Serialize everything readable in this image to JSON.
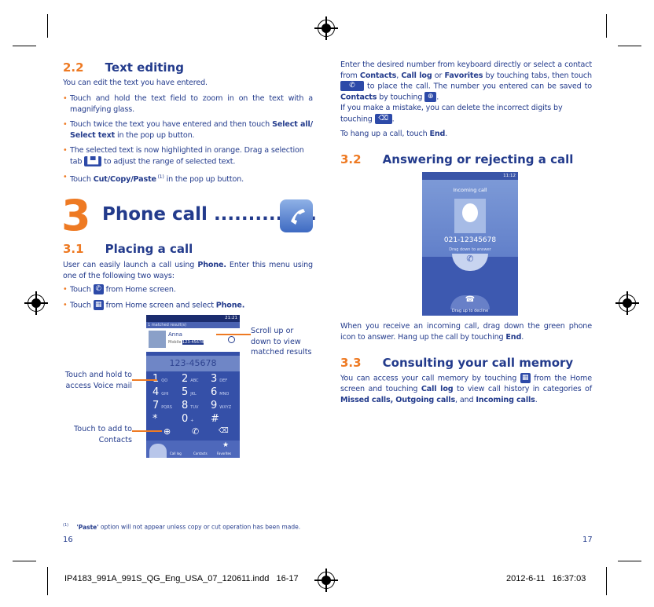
{
  "left": {
    "section_2_2": {
      "number": "2.2",
      "title": "Text editing"
    },
    "intro": "You can edit the text you have entered.",
    "bullets": [
      [
        {
          "t": "Touch and hold the text field to zoom in on the text with a magnifying glass."
        }
      ],
      [
        {
          "t": "Touch twice the text you have entered and then touch "
        },
        {
          "t": "Select all/ Select text",
          "b": true
        },
        {
          "t": " in the pop up button."
        }
      ],
      [
        {
          "t": "The selected text is now highlighted in orange. Drag a selection tab "
        },
        {
          "t": "[selection-tabs-icon]",
          "icon": "selection-tabs"
        },
        {
          "t": " to adjust the range of selected text."
        }
      ],
      [
        {
          "t": "Touch "
        },
        {
          "t": "Cut/Copy/Paste",
          "b": true
        },
        {
          "t": " (1)",
          "sup": true
        },
        {
          "t": " in the pop up button."
        }
      ]
    ],
    "chapter": {
      "number": "3",
      "title": "Phone call ...............",
      "icon": "phone-app-icon"
    },
    "section_3_1": {
      "number": "3.1",
      "title": "Placing a call"
    },
    "placing_intro": [
      {
        "t": "User can easily launch a call using "
      },
      {
        "t": "Phone.",
        "b": true
      },
      {
        "t": " Enter this menu using one of the following two ways:"
      }
    ],
    "placing_bullets": [
      [
        {
          "t": "Touch "
        },
        {
          "t": "[phone-icon]",
          "icon": "phone"
        },
        {
          "t": " from Home screen."
        }
      ],
      [
        {
          "t": "Touch "
        },
        {
          "t": "[apps-icon]",
          "icon": "apps"
        },
        {
          "t": " from Home screen and select "
        },
        {
          "t": "Phone.",
          "b": true
        }
      ]
    ],
    "dialer_screenshot": {
      "status_time": "21:21",
      "matched": "1 matched result(s)",
      "contact_name": "Anna",
      "contact_type": "Mobile",
      "contact_number": "123-45678",
      "display_number": "123-45678",
      "keys": [
        {
          "d": "1",
          "l": "QO"
        },
        {
          "d": "2",
          "l": "ABC"
        },
        {
          "d": "3",
          "l": "DEF"
        },
        {
          "d": "4",
          "l": "GHI"
        },
        {
          "d": "5",
          "l": "JKL"
        },
        {
          "d": "6",
          "l": "MNO"
        },
        {
          "d": "7",
          "l": "PQRS"
        },
        {
          "d": "8",
          "l": "TUV"
        },
        {
          "d": "9",
          "l": "WXYZ"
        },
        {
          "d": "*",
          "l": ""
        },
        {
          "d": "0",
          "l": "+"
        },
        {
          "d": "#",
          "l": ""
        }
      ],
      "tabs": [
        "Call log",
        "Contacts",
        "Favorites"
      ]
    },
    "callouts": {
      "scroll": "Scroll up or down to view matched results",
      "voicemail": "Touch and hold to access Voice mail",
      "add_contact": "Touch to add to Contacts"
    },
    "footnote": {
      "marker": "(1)",
      "bold": "'Paste'",
      "text": " option will not appear unless copy or cut operation has been made."
    },
    "page_number": "16"
  },
  "right": {
    "para1": [
      {
        "t": "Enter the desired number from keyboard directly or select a contact from "
      },
      {
        "t": "Contacts",
        "b": true
      },
      {
        "t": ", "
      },
      {
        "t": "Call log",
        "b": true
      },
      {
        "t": " or "
      },
      {
        "t": "Favorites",
        "b": true
      },
      {
        "t": " by touching tabs, then touch "
      },
      {
        "t": "[call-button-icon]",
        "icon": "call-button"
      },
      {
        "t": " to place the call. The number you entered can be saved to "
      },
      {
        "t": "Contacts",
        "b": true
      },
      {
        "t": " by touching "
      },
      {
        "t": "[add-contact-icon]",
        "icon": "add"
      },
      {
        "t": "."
      }
    ],
    "para2": [
      {
        "t": "If you make a mistake, you can delete the incorrect digits by touching "
      },
      {
        "t": "[delete-icon]",
        "icon": "delete"
      },
      {
        "t": "."
      }
    ],
    "para3": [
      {
        "t": "To hang up a call, touch "
      },
      {
        "t": "End",
        "b": true
      },
      {
        "t": "."
      }
    ],
    "section_3_2": {
      "number": "3.2",
      "title": "Answering or rejecting a call"
    },
    "incoming_screenshot": {
      "status_time": "11:12",
      "title": "Incoming call",
      "number": "021-12345678",
      "answer_hint": "Drag down to answer",
      "decline_hint": "Drag up to decline"
    },
    "para4": [
      {
        "t": "When you receive an incoming call, drag down the green phone icon to answer. Hang up the call by touching "
      },
      {
        "t": "End",
        "b": true
      },
      {
        "t": "."
      }
    ],
    "section_3_3": {
      "number": "3.3",
      "title": "Consulting your call memory"
    },
    "para5": [
      {
        "t": "You can access your call memory by touching "
      },
      {
        "t": "[apps-icon]",
        "icon": "apps"
      },
      {
        "t": " from the Home screen and touching "
      },
      {
        "t": "Call log",
        "b": true
      },
      {
        "t": " to view call history in categories of "
      },
      {
        "t": "Missed calls, Outgoing calls",
        "b": true
      },
      {
        "t": ", and "
      },
      {
        "t": "Incoming calls",
        "b": true
      },
      {
        "t": "."
      }
    ],
    "page_number": "17"
  },
  "slug": {
    "file": "IP4183_991A_991S_QG_Eng_USA_07_120611.indd   16-17",
    "datetime": "2012-6-11   16:37:03"
  },
  "colors": {
    "text": "#233b8c",
    "accent": "#ee7a23",
    "screen": "#3550a8"
  }
}
